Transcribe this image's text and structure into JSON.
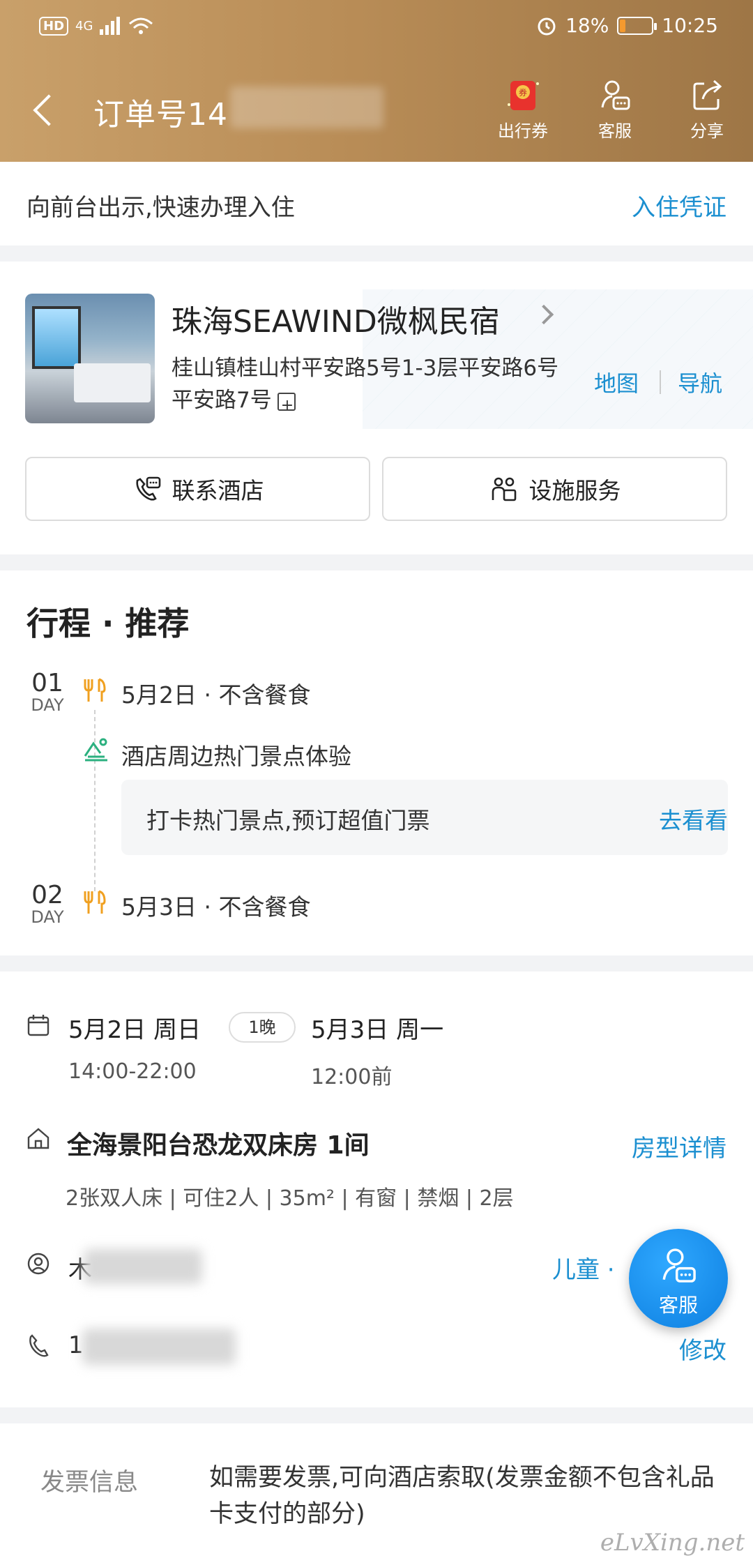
{
  "status_bar": {
    "hd": "HD",
    "network": "4G",
    "battery_pct": "18%",
    "battery_level": 0.18,
    "time": "10:25"
  },
  "header": {
    "order_prefix": "订单号14",
    "actions": [
      {
        "label": "出行券",
        "icon": "coupon-icon"
      },
      {
        "label": "客服",
        "icon": "customer-service-icon"
      },
      {
        "label": "分享",
        "icon": "share-icon"
      }
    ]
  },
  "checkin": {
    "hint": "向前台出示,快速办理入住",
    "voucher_link": "入住凭证"
  },
  "hotel": {
    "name": "珠海SEAWIND微枫民宿",
    "address": "桂山镇桂山村平安路5号1-3层平安路6号平安路7号",
    "map_link": "地图",
    "nav_link": "导航",
    "contact_button": "联系酒店",
    "facility_button": "设施服务"
  },
  "itinerary": {
    "title": "行程 · 推荐",
    "day_label": "DAY",
    "days": [
      {
        "num": "01",
        "text": "5月2日 · 不含餐食"
      },
      {
        "num": "02",
        "text": "5月3日 · 不含餐食"
      }
    ],
    "attraction": "酒店周边热门景点体验",
    "rec_text": "打卡热门景点,预订超值门票",
    "rec_link": "去看看"
  },
  "booking": {
    "checkin_date": "5月2日 周日",
    "nights": "1晚",
    "checkout_date": "5月3日 周一",
    "checkin_time": "14:00-22:00",
    "checkout_time": "12:00前",
    "room": "全海景阳台恐龙双床房 1间",
    "room_detail_link": "房型详情",
    "room_features": "2张双人床 | 可住2人 | 35m² | 有窗 | 禁烟 | 2层",
    "guest_initial": "木",
    "child_link": "儿童 · ",
    "phone_prefix": "1",
    "modify_link": "修改"
  },
  "fab": {
    "label": "客服"
  },
  "invoice": {
    "label": "发票信息",
    "text": "如需要发票,可向酒店索取(发票金额不包含礼品卡支付的部分)"
  },
  "watermark": "eLvXing.net",
  "colors": {
    "header_gold": "#b98d57",
    "link_blue": "#1b8fd0",
    "meal_orange": "#f0a020",
    "attraction_green": "#2bb07f",
    "fab_blue": "#1a8ff0"
  }
}
